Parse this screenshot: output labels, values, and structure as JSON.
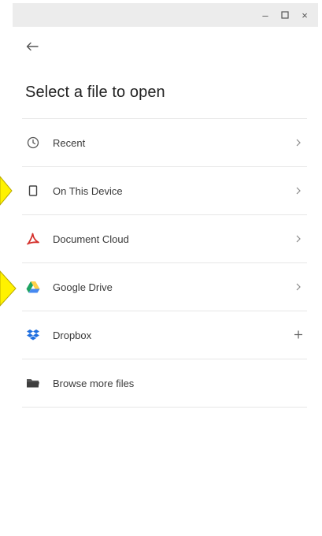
{
  "window": {
    "minimize_glyph": "–",
    "maximize_glyph": "☐",
    "close_glyph": "×"
  },
  "page": {
    "title": "Select a file to open"
  },
  "items": [
    {
      "label": "Recent",
      "icon": "clock-icon",
      "trailing": "chevron-right-icon"
    },
    {
      "label": "On This Device",
      "icon": "device-icon",
      "trailing": "chevron-right-icon"
    },
    {
      "label": "Document Cloud",
      "icon": "document-cloud-icon",
      "trailing": "chevron-right-icon"
    },
    {
      "label": "Google Drive",
      "icon": "google-drive-icon",
      "trailing": "chevron-right-icon"
    },
    {
      "label": "Dropbox",
      "icon": "dropbox-icon",
      "trailing": "plus-icon"
    },
    {
      "label": "Browse more files",
      "icon": "folder-icon",
      "trailing": ""
    }
  ],
  "colors": {
    "acrobat_red": "#d4302b",
    "dropbox_blue": "#1f6fe0",
    "drive_green": "#1fa463",
    "drive_yellow": "#ffd04b",
    "drive_blue": "#4688f1",
    "annotation_yellow": "#fff200"
  }
}
